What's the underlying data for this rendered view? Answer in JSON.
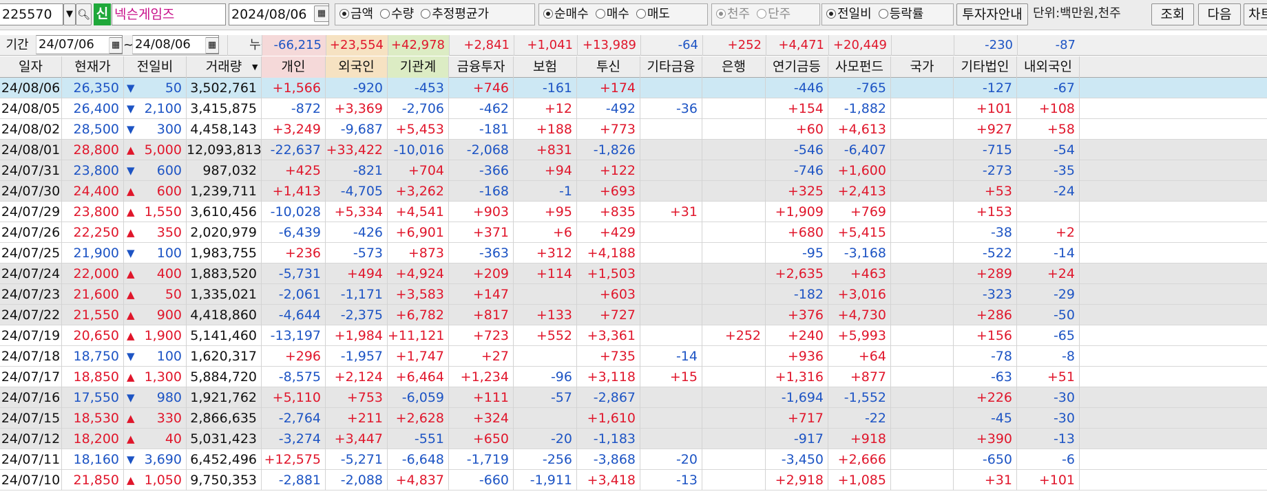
{
  "toolbar": {
    "code": "225570",
    "shin_label": "신",
    "stock_name": "넥슨게임즈",
    "date": "2024/08/06",
    "radio_a": [
      {
        "label": "금액",
        "on": true
      },
      {
        "label": "수량",
        "on": false
      },
      {
        "label": "추정평균가",
        "on": false
      }
    ],
    "radio_b": [
      {
        "label": "순매수",
        "on": true
      },
      {
        "label": "매수",
        "on": false
      },
      {
        "label": "매도",
        "on": false
      }
    ],
    "radio_c": [
      {
        "label": "천주",
        "on": true
      },
      {
        "label": "단주",
        "on": false
      }
    ],
    "radio_d": [
      {
        "label": "전일비",
        "on": true
      },
      {
        "label": "등락률",
        "on": false
      }
    ],
    "investor_guide_button": "투자자안내",
    "unit_label": "단위:백만원,천주",
    "search_button": "조회",
    "next_button": "다음",
    "chart_button": "차트"
  },
  "period": {
    "label": "기간",
    "from": "24/07/06",
    "to": "24/08/06",
    "tilde": "~",
    "cumulative_label": "누적순매수"
  },
  "totals": [
    "-66,215",
    "+23,554",
    "+42,978",
    "+2,841",
    "+1,041",
    "+13,989",
    "-64",
    "+252",
    "+4,471",
    "+20,449",
    "",
    "-230",
    "-87"
  ],
  "columns": [
    "일자",
    "현재가",
    "전일비",
    "거래량",
    "개인",
    "외국인",
    "기관계",
    "금융투자",
    "보험",
    "투신",
    "기타금융",
    "은행",
    "연기금등",
    "사모펀드",
    "국가",
    "기타법인",
    "내외국인"
  ],
  "colors": {
    "up": "#e0162b",
    "down": "#1d54c4",
    "indiv_bg": "#f5d9d9",
    "foreign_bg": "#f6e2c2",
    "inst_bg": "#dcecc4",
    "selected_row": "#cde8f4"
  },
  "rows": [
    [
      "24/08/06",
      "26,350",
      "down",
      "50",
      "3,502,761",
      "+1,566",
      "-920",
      "-453",
      "+746",
      "-161",
      "+174",
      "",
      "",
      "-446",
      "-765",
      "",
      "-127",
      "-67"
    ],
    [
      "24/08/05",
      "26,400",
      "down",
      "2,100",
      "3,415,875",
      "-872",
      "+3,369",
      "-2,706",
      "-462",
      "+12",
      "-492",
      "-36",
      "",
      "+154",
      "-1,882",
      "",
      "+101",
      "+108"
    ],
    [
      "24/08/02",
      "28,500",
      "down",
      "300",
      "4,458,143",
      "+3,249",
      "-9,687",
      "+5,453",
      "-181",
      "+188",
      "+773",
      "",
      "",
      "+60",
      "+4,613",
      "",
      "+927",
      "+58"
    ],
    [
      "24/08/01",
      "28,800",
      "up",
      "5,000",
      "12,093,813",
      "-22,637",
      "+33,422",
      "-10,016",
      "-2,068",
      "+831",
      "-1,826",
      "",
      "",
      "-546",
      "-6,407",
      "",
      "-715",
      "-54"
    ],
    [
      "24/07/31",
      "23,800",
      "down",
      "600",
      "987,032",
      "+425",
      "-821",
      "+704",
      "-366",
      "+94",
      "+122",
      "",
      "",
      "-746",
      "+1,600",
      "",
      "-273",
      "-35"
    ],
    [
      "24/07/30",
      "24,400",
      "up",
      "600",
      "1,239,711",
      "+1,413",
      "-4,705",
      "+3,262",
      "-168",
      "-1",
      "+693",
      "",
      "",
      "+325",
      "+2,413",
      "",
      "+53",
      "-24"
    ],
    [
      "24/07/29",
      "23,800",
      "up",
      "1,550",
      "3,610,456",
      "-10,028",
      "+5,334",
      "+4,541",
      "+903",
      "+95",
      "+835",
      "+31",
      "",
      "+1,909",
      "+769",
      "",
      "+153",
      ""
    ],
    [
      "24/07/26",
      "22,250",
      "up",
      "350",
      "2,020,979",
      "-6,439",
      "-426",
      "+6,901",
      "+371",
      "+6",
      "+429",
      "",
      "",
      "+680",
      "+5,415",
      "",
      "-38",
      "+2"
    ],
    [
      "24/07/25",
      "21,900",
      "down",
      "100",
      "1,983,755",
      "+236",
      "-573",
      "+873",
      "-363",
      "+312",
      "+4,188",
      "",
      "",
      "-95",
      "-3,168",
      "",
      "-522",
      "-14"
    ],
    [
      "24/07/24",
      "22,000",
      "up",
      "400",
      "1,883,520",
      "-5,731",
      "+494",
      "+4,924",
      "+209",
      "+114",
      "+1,503",
      "",
      "",
      "+2,635",
      "+463",
      "",
      "+289",
      "+24"
    ],
    [
      "24/07/23",
      "21,600",
      "up",
      "50",
      "1,335,021",
      "-2,061",
      "-1,171",
      "+3,583",
      "+147",
      "",
      "+603",
      "",
      "",
      "-182",
      "+3,016",
      "",
      "-323",
      "-29"
    ],
    [
      "24/07/22",
      "21,550",
      "up",
      "900",
      "4,418,860",
      "-4,644",
      "-2,375",
      "+6,782",
      "+817",
      "+133",
      "+727",
      "",
      "",
      "+376",
      "+4,730",
      "",
      "+286",
      "-50"
    ],
    [
      "24/07/19",
      "20,650",
      "up",
      "1,900",
      "5,141,460",
      "-13,197",
      "+1,984",
      "+11,121",
      "+723",
      "+552",
      "+3,361",
      "",
      "+252",
      "+240",
      "+5,993",
      "",
      "+156",
      "-65"
    ],
    [
      "24/07/18",
      "18,750",
      "down",
      "100",
      "1,620,317",
      "+296",
      "-1,957",
      "+1,747",
      "+27",
      "",
      "+735",
      "-14",
      "",
      "+936",
      "+64",
      "",
      "-78",
      "-8"
    ],
    [
      "24/07/17",
      "18,850",
      "up",
      "1,300",
      "5,884,720",
      "-8,575",
      "+2,124",
      "+6,464",
      "+1,234",
      "-96",
      "+3,118",
      "+15",
      "",
      "+1,316",
      "+877",
      "",
      "-63",
      "+51"
    ],
    [
      "24/07/16",
      "17,550",
      "down",
      "980",
      "1,921,762",
      "+5,110",
      "+753",
      "-6,059",
      "+111",
      "-57",
      "-2,867",
      "",
      "",
      "-1,694",
      "-1,552",
      "",
      "+226",
      "-30"
    ],
    [
      "24/07/15",
      "18,530",
      "up",
      "330",
      "2,866,635",
      "-2,764",
      "+211",
      "+2,628",
      "+324",
      "",
      "+1,610",
      "",
      "",
      "+717",
      "-22",
      "",
      "-45",
      "-30"
    ],
    [
      "24/07/12",
      "18,200",
      "up",
      "40",
      "5,031,423",
      "-3,274",
      "+3,447",
      "-551",
      "+650",
      "-20",
      "-1,183",
      "",
      "",
      "-917",
      "+918",
      "",
      "+390",
      "-13"
    ],
    [
      "24/07/11",
      "18,160",
      "down",
      "3,690",
      "6,452,496",
      "+12,575",
      "-5,271",
      "-6,648",
      "-1,719",
      "-256",
      "-3,868",
      "-20",
      "",
      "-3,450",
      "+2,666",
      "",
      "-650",
      "-6"
    ],
    [
      "24/07/10",
      "21,850",
      "up",
      "1,050",
      "9,750,353",
      "-2,881",
      "-2,088",
      "+4,837",
      "-660",
      "-1,911",
      "+3,418",
      "-13",
      "",
      "+2,918",
      "+1,085",
      "",
      "+31",
      "+101"
    ]
  ]
}
